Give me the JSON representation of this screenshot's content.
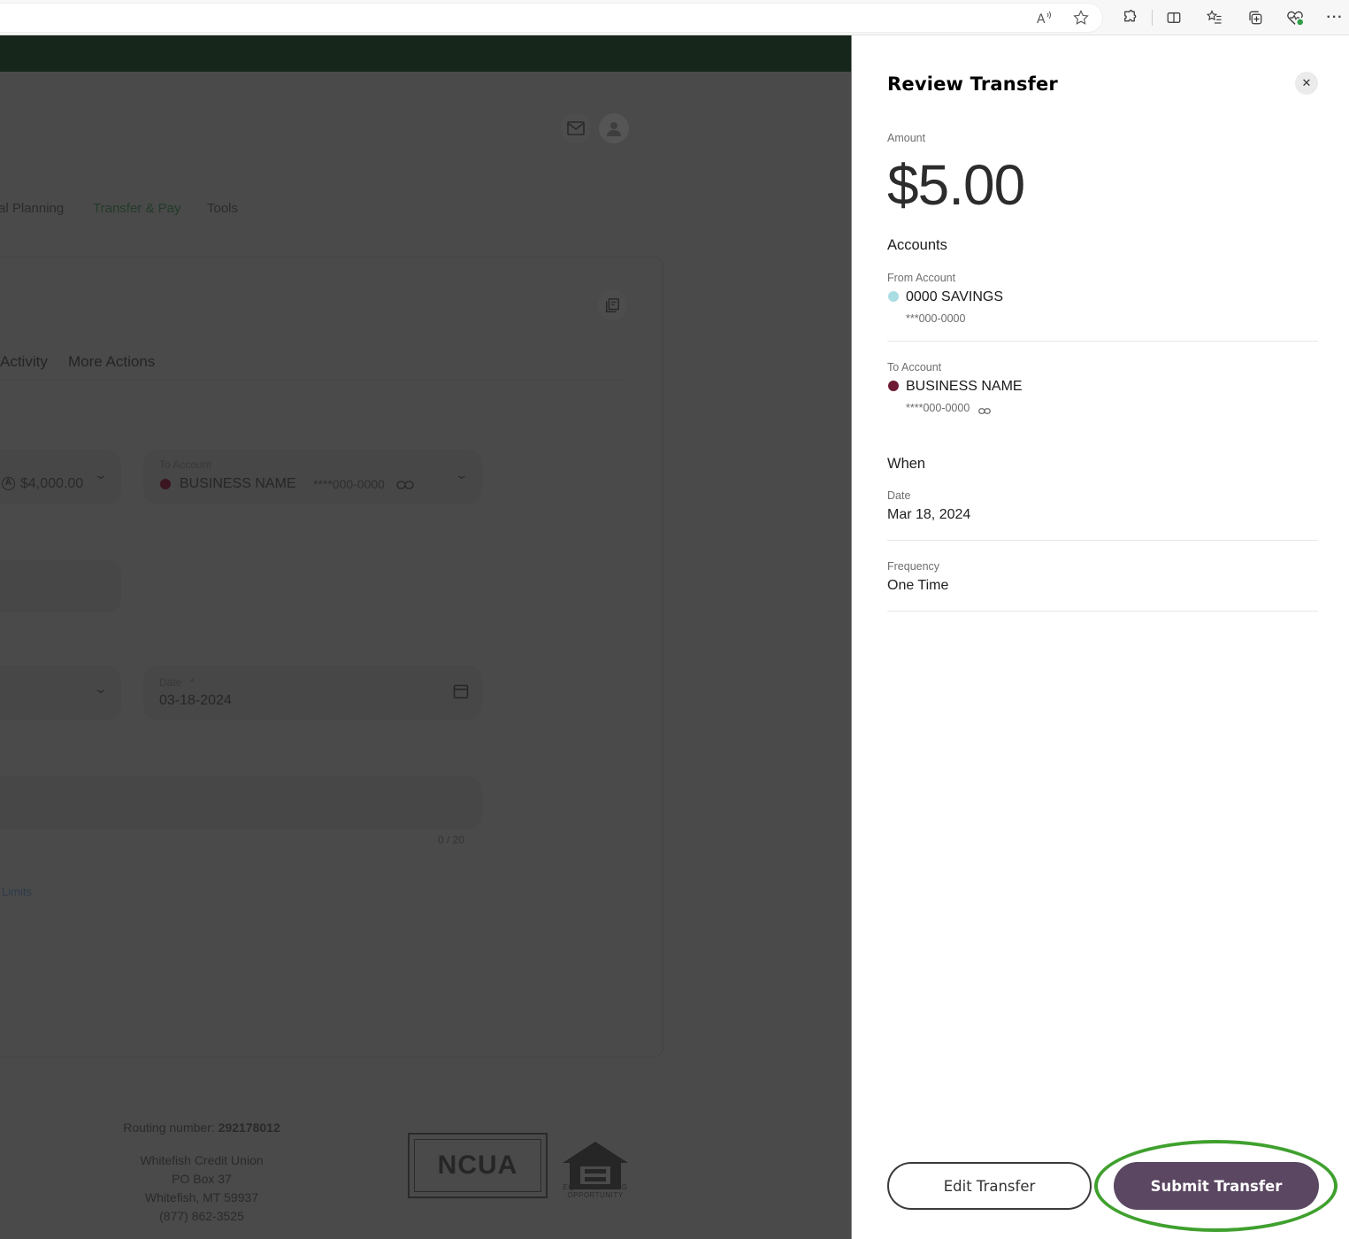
{
  "browser": {
    "icons": [
      "read-aloud-icon",
      "favorite-star-icon",
      "extensions-icon",
      "split-screen-icon",
      "favorites-list-icon",
      "collections-icon",
      "browser-essentials-icon",
      "more-options-icon"
    ]
  },
  "background": {
    "nav": [
      "al Planning",
      "Transfer & Pay",
      "Tools"
    ],
    "tabs": [
      "Activity",
      "More Actions"
    ],
    "from_balance": "$4,000.00",
    "to_account": {
      "label": "To Account",
      "name": "BUSINESS NAME",
      "number": "****000-0000"
    },
    "date_field": {
      "label": "Date",
      "required_mark": "*",
      "value": "03-18-2024"
    },
    "memo_counter": "0 / 20",
    "limits_link": "Limits",
    "footer": {
      "routing_label": "Routing number:",
      "routing_number": "292178012",
      "address": [
        "Whitefish Credit Union",
        "PO Box 37",
        "Whitefish, MT 59937",
        "(877) 862-3525"
      ],
      "ncua_logo": "NCUA",
      "equal_housing": [
        "EQUAL HOUSING",
        "OPPORTUNITY"
      ]
    }
  },
  "review": {
    "title": "Review Transfer",
    "amount_label": "Amount",
    "amount": "$5.00",
    "accounts_heading": "Accounts",
    "from": {
      "label": "From Account",
      "name": "0000 SAVINGS",
      "number": "***000-0000",
      "color": "#a9dde3"
    },
    "to": {
      "label": "To Account",
      "name": "BUSINESS NAME",
      "number": "****000-0000",
      "color": "#6e1a33"
    },
    "when_heading": "When",
    "date_label": "Date",
    "date": "Mar 18, 2024",
    "frequency_label": "Frequency",
    "frequency": "One Time",
    "edit_button": "Edit Transfer",
    "submit_button": "Submit Transfer",
    "submit_color": "#5b4762",
    "highlight_color": "#3fa02e"
  }
}
